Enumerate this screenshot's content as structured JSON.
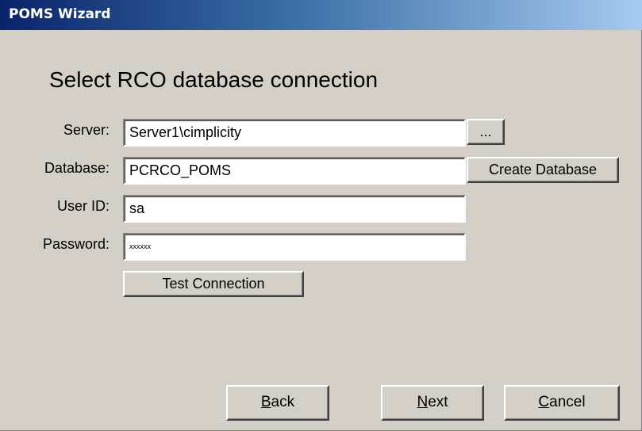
{
  "window": {
    "title": "POMS Wizard"
  },
  "page": {
    "heading": "Select RCO database connection"
  },
  "form": {
    "server_label": "Server:",
    "server_value": "Server1\\cimplicity",
    "browse_label": "...",
    "database_label": "Database:",
    "database_value": "PCRCO_POMS",
    "create_db_label": "Create Database",
    "userid_label": "User ID:",
    "userid_value": "sa",
    "password_label": "Password:",
    "password_value": "xxxxxx",
    "test_label": "Test Connection"
  },
  "footer": {
    "back": {
      "mnemonic": "B",
      "rest": "ack"
    },
    "next": {
      "mnemonic": "N",
      "rest": "ext"
    },
    "cancel": {
      "mnemonic": "C",
      "rest": "ancel"
    }
  }
}
